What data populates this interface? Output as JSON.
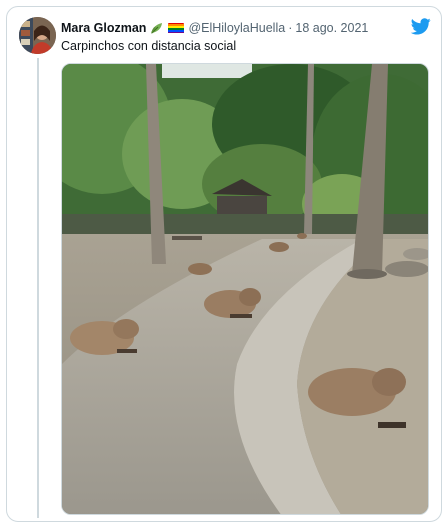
{
  "tweet": {
    "display_name": "Mara Glozman",
    "handle": "@ElHiloylaHuella",
    "separator": "·",
    "date": "18 ago. 2021",
    "text": "Carpinchos con distancia social",
    "icons": {
      "verified_emoji": "herb-emoji-icon",
      "flag_emoji": "rainbow-flag-icon",
      "platform": "twitter-bird-icon"
    },
    "colors": {
      "brand_blue": "#1d9bf0",
      "handle_gray": "#536471",
      "border": "#cfd9de"
    }
  },
  "media": {
    "type": "photo",
    "subject": "capybaras"
  }
}
